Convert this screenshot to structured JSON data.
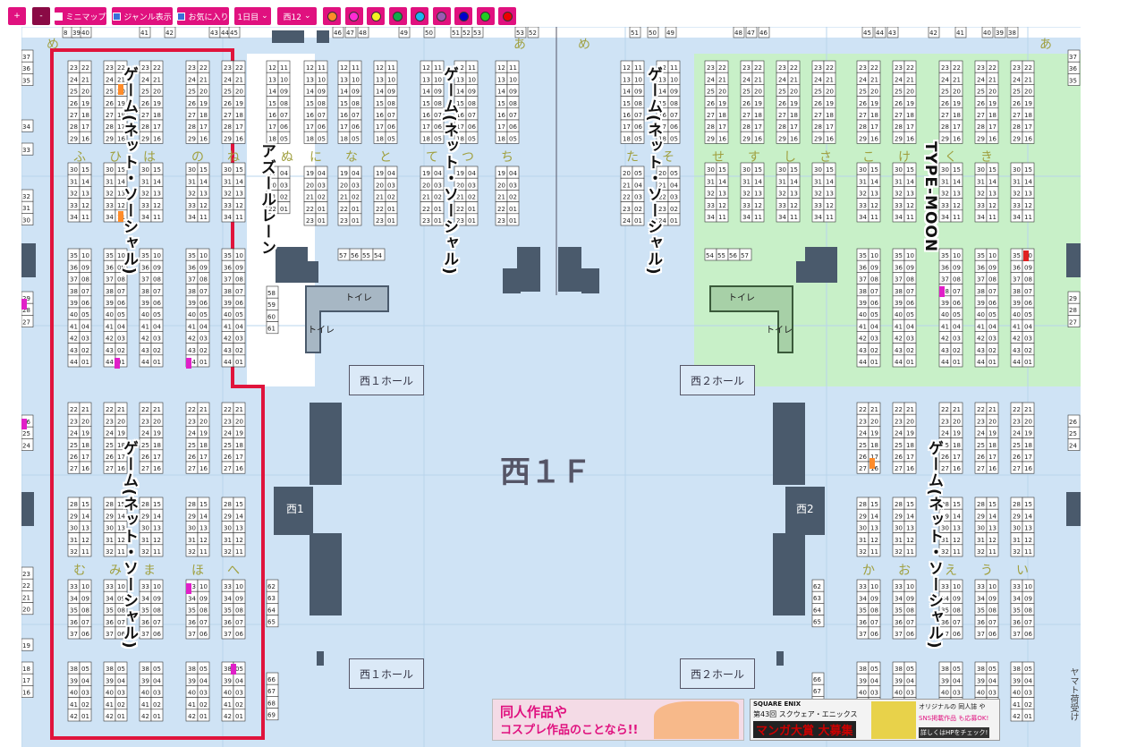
{
  "toolbar": {
    "plus": "+",
    "minus": "-",
    "minimap": "ミニマップ",
    "genre": "ジャンル表示",
    "fav": "お気に入り",
    "day": "1日目",
    "hall": "西12",
    "colors": [
      "#ff8c2a",
      "#ff2bd4",
      "#f4f022",
      "#12a84a",
      "#1ab6f0",
      "#9b5ab3",
      "#0000cc",
      "#22cc22",
      "#ee0000"
    ]
  },
  "map": {
    "hall_title": "西１Ｆ",
    "hall1_tag_top": "西１ホール",
    "hall2_tag_top": "西２ホール",
    "hall1_tag_bottom": "西１ホール",
    "hall2_tag_bottom": "西２ホール",
    "hall1_label": "西1",
    "hall2_label": "西2",
    "toilet1": "トイレ",
    "toilet2": "トイレ",
    "toilet3": "トイレ",
    "toilet4": "トイレ",
    "yamato": "ヤマト荷受け",
    "top_numbers": [
      "8",
      "39",
      "40",
      "41",
      "42",
      "43",
      "44",
      "45",
      "46",
      "47",
      "48",
      "49",
      "50",
      "51",
      "52",
      "53",
      "53",
      "52",
      "51",
      "50",
      "49",
      "48",
      "47",
      "46",
      "45",
      "44",
      "43",
      "42",
      "41",
      "40",
      "39",
      "38"
    ],
    "top_kana": [
      "め",
      "あ",
      "め",
      "あ"
    ],
    "row_labels_top": [
      "ふ",
      "ひ",
      "は",
      "の",
      "ね",
      "ぬ",
      "に",
      "な",
      "と",
      "て",
      "つ",
      "ち",
      "た",
      "そ",
      "せ",
      "す",
      "し",
      "さ",
      "こ",
      "け",
      "く",
      "き"
    ],
    "row_labels_bottom_left": [
      "む",
      "み",
      "ま",
      "ほ",
      "へ"
    ],
    "row_labels_bottom_right": [
      "か",
      "お",
      "え",
      "う",
      "い"
    ],
    "island_57_56": [
      "57",
      "56",
      "55",
      "54"
    ],
    "island_54_57": [
      "54",
      "55",
      "56",
      "57"
    ],
    "left_edge_numbers": [
      "37",
      "36",
      "35",
      "34",
      "33",
      "32",
      "31",
      "30",
      "29",
      "28",
      "27",
      "26",
      "25",
      "24",
      "23",
      "22",
      "21",
      "20",
      "19",
      "18",
      "17",
      "16"
    ],
    "right_edge_numbers": [
      "58",
      "59",
      "60",
      "61",
      "62",
      "63",
      "64",
      "65",
      "66",
      "67",
      "68",
      "69"
    ],
    "genre_labels": [
      "ゲーム(ネット・ソーシャル)",
      "アズールレーン",
      "ゲーム(ネット・ソーシャル)",
      "ゲーム(ネット・ソーシャル)",
      "TYPE-MOON",
      "ゲーム(ネット・ソーシャル)",
      "ゲーム(ネット・ソーシャル)"
    ]
  },
  "banners": {
    "left_line1": "同人作品や",
    "left_line2": "コスプレ作品のことなら!!",
    "right_brand": "SQUARE ENIX",
    "right_title": "第43回 スクウェア・エニックス",
    "right_main": "マンガ大賞 大募集",
    "right_side1": "オリジナルの 同人誌 や",
    "right_side2": "SNS掲載作品 も応募OK!",
    "right_side3": "詳しくはHPをチェック!"
  }
}
